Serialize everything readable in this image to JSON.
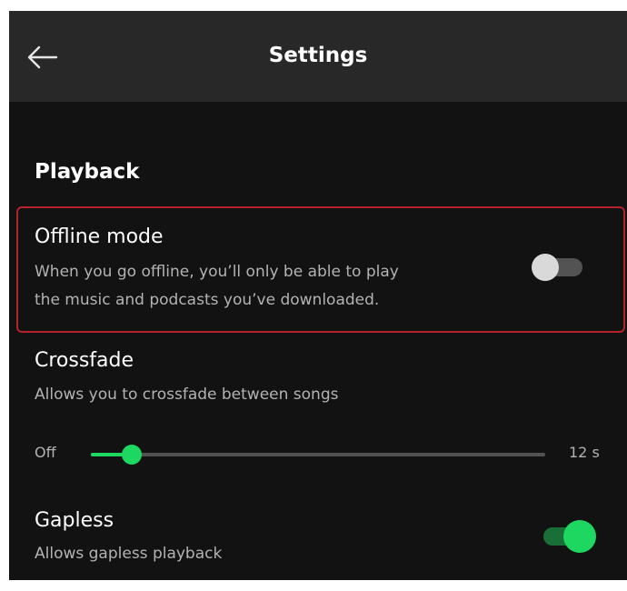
{
  "header": {
    "title": "Settings",
    "back_icon": "arrow-left-icon"
  },
  "section": {
    "title": "Playback"
  },
  "settings": {
    "offline": {
      "title": "Offline mode",
      "desc_line1": "When you go offline, you’ll only be able to play",
      "desc_line2": "the music and podcasts you’ve downloaded.",
      "enabled": false
    },
    "crossfade": {
      "title": "Crossfade",
      "desc": "Allows you to crossfade between songs",
      "min_label": "Off",
      "max_label": "12 s",
      "value_fraction": 0.09
    },
    "gapless": {
      "title": "Gapless",
      "desc": "Allows gapless playback",
      "enabled": true
    }
  },
  "colors": {
    "accent": "#1ed760",
    "highlight_border": "#b4232c",
    "background": "#121212",
    "header": "#282828"
  }
}
